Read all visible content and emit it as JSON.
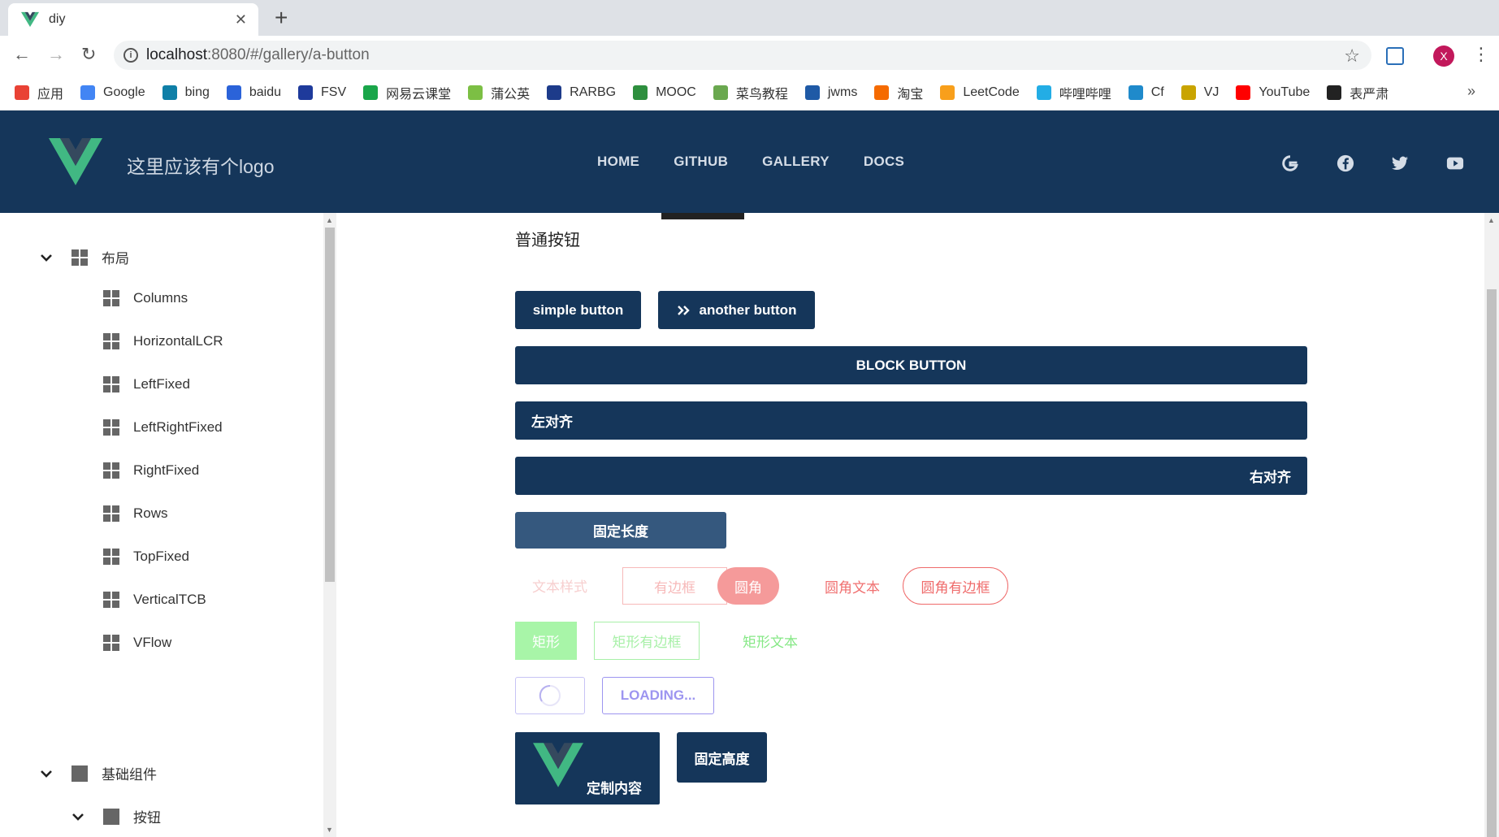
{
  "browser": {
    "tab_title": "diy",
    "url_host": "localhost",
    "url_path": ":8080/#/gallery/a-button",
    "profile_initial": "X",
    "bookmarks": [
      {
        "label": "应用",
        "icon": "apps-grid-icon",
        "color": "#e94235"
      },
      {
        "label": "Google",
        "icon": "google-icon",
        "color": "#4285f4"
      },
      {
        "label": "bing",
        "icon": "bing-icon",
        "color": "#0f7fa7"
      },
      {
        "label": "baidu",
        "icon": "baidu-icon",
        "color": "#2b63d9"
      },
      {
        "label": "FSV",
        "icon": "fsv-icon",
        "color": "#1e3a9b"
      },
      {
        "label": "网易云课堂",
        "icon": "netease-study-icon",
        "color": "#1aa64a"
      },
      {
        "label": "蒲公英",
        "icon": "pgyer-icon",
        "color": "#7cbf44"
      },
      {
        "label": "RARBG",
        "icon": "rarbg-icon",
        "color": "#1d3b8a"
      },
      {
        "label": "MOOC",
        "icon": "mooc-icon",
        "color": "#2e8f3e"
      },
      {
        "label": "菜鸟教程",
        "icon": "runoob-icon",
        "color": "#6aa84f"
      },
      {
        "label": "jwms",
        "icon": "jwms-icon",
        "color": "#1f5aa6"
      },
      {
        "label": "淘宝",
        "icon": "taobao-icon",
        "color": "#f56a00"
      },
      {
        "label": "LeetCode",
        "icon": "leetcode-icon",
        "color": "#f89f1b"
      },
      {
        "label": "哔哩哔哩",
        "icon": "bilibili-icon",
        "color": "#23ade5"
      },
      {
        "label": "Cf",
        "icon": "codeforces-icon",
        "color": "#1f8acb"
      },
      {
        "label": "VJ",
        "icon": "vjudge-icon",
        "color": "#c9a400"
      },
      {
        "label": "YouTube",
        "icon": "youtube-icon",
        "color": "#ff0000"
      },
      {
        "label": "表严肃",
        "icon": "biaoyansu-icon",
        "color": "#222222"
      }
    ]
  },
  "header": {
    "brand": "这里应该有个logo",
    "nav": [
      "HOME",
      "GITHUB",
      "GALLERY",
      "DOCS"
    ],
    "social": [
      "google-icon",
      "facebook-icon",
      "twitter-icon",
      "youtube-icon"
    ],
    "bg_color": "#15365a"
  },
  "sidebar": {
    "group_layout": "布局",
    "layout_items": [
      "Columns",
      "HorizontalLCR",
      "LeftFixed",
      "LeftRightFixed",
      "RightFixed",
      "Rows",
      "TopFixed",
      "VerticalTCB",
      "VFlow"
    ],
    "group_basic": "基础组件",
    "basic_child": "按钮"
  },
  "content": {
    "subtitle": "普通按钮",
    "simple_button": "simple button",
    "another_button": "another button",
    "block_button": "BLOCK BUTTON",
    "left_align": "左对齐",
    "right_align": "右对齐",
    "fixed_width": "固定长度",
    "text_style": "文本样式",
    "bordered": "有边框",
    "rounded": "圆角",
    "rounded_text": "圆角文本",
    "rounded_bordered": "圆角有边框",
    "rect": "矩形",
    "rect_bordered": "矩形有边框",
    "rect_text": "矩形文本",
    "loading": "LOADING...",
    "custom_content": "定制内容",
    "fixed_height": "固定高度",
    "colors": {
      "primary": "#15365a",
      "fixed_width_bg": "#35587e",
      "pink": "#f28b8b",
      "pink_light": "#f7b9b9",
      "green": "#a8f0a8",
      "green_text": "#7ee07e",
      "purple": "#9d95f0",
      "vue_green": "#41b883",
      "vue_dark": "#35495e"
    }
  }
}
